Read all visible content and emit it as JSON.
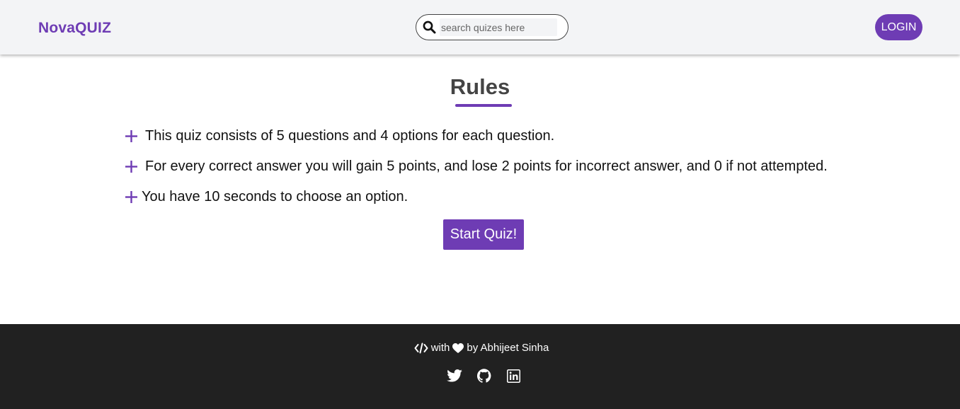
{
  "brand": "NovaQUIZ",
  "search": {
    "placeholder": "search quizes here",
    "icon": "search-icon"
  },
  "nav": {
    "login_label": "LOGIN"
  },
  "rules": {
    "title": "Rules",
    "items": [
      "This quiz consists of 5 questions and 4 options for each question.",
      "For every correct answer you will gain 5 points, and lose 2 points for incorrect answer, and 0 if not attempted.",
      "You have 10 seconds to choose an option."
    ],
    "bullet_icon": "plus-icon"
  },
  "start_label": "Start Quiz!",
  "footer": {
    "with": "with",
    "by": "by Abhijeet Sinha",
    "icons": [
      "code-icon",
      "heart-icon",
      "twitter-icon",
      "github-icon",
      "linkedin-icon"
    ]
  },
  "colors": {
    "accent": "#6e3cb4",
    "footer_bg": "#212121",
    "navbar_bg": "#f3f4f6"
  }
}
